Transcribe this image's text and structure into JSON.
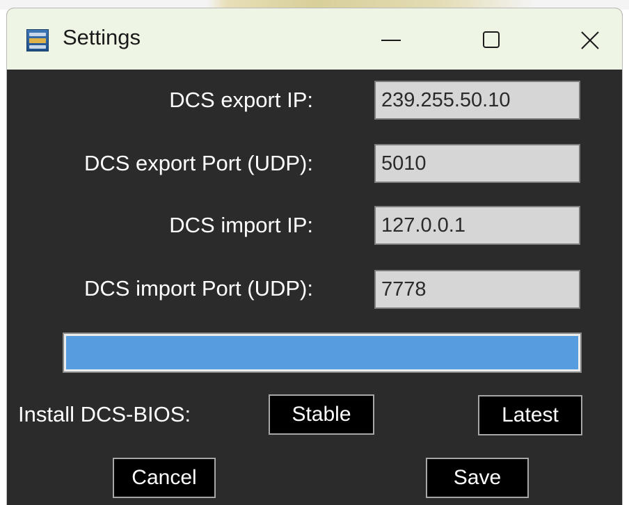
{
  "window": {
    "title": "Settings"
  },
  "form": {
    "export_ip": {
      "label": "DCS export IP:",
      "value": "239.255.50.10"
    },
    "export_port": {
      "label": "DCS export Port (UDP):",
      "value": "5010"
    },
    "import_ip": {
      "label": "DCS import IP:",
      "value": "127.0.0.1"
    },
    "import_port": {
      "label": "DCS import Port (UDP):",
      "value": "7778"
    }
  },
  "progress": {
    "value_percent": 100,
    "color": "#569de0"
  },
  "install": {
    "label": "Install DCS-BIOS:",
    "stable_label": "Stable",
    "latest_label": "Latest"
  },
  "actions": {
    "cancel_label": "Cancel",
    "save_label": "Save"
  },
  "icons": {
    "app": "dcs-bios-app-icon",
    "minimize": "minimize-icon",
    "maximize": "maximize-icon",
    "close": "close-icon"
  },
  "colors": {
    "window_bg": "#2b2b2b",
    "titlebar_bg": "#eef5e5",
    "field_bg": "#d6d6d6",
    "button_bg": "#000000"
  }
}
